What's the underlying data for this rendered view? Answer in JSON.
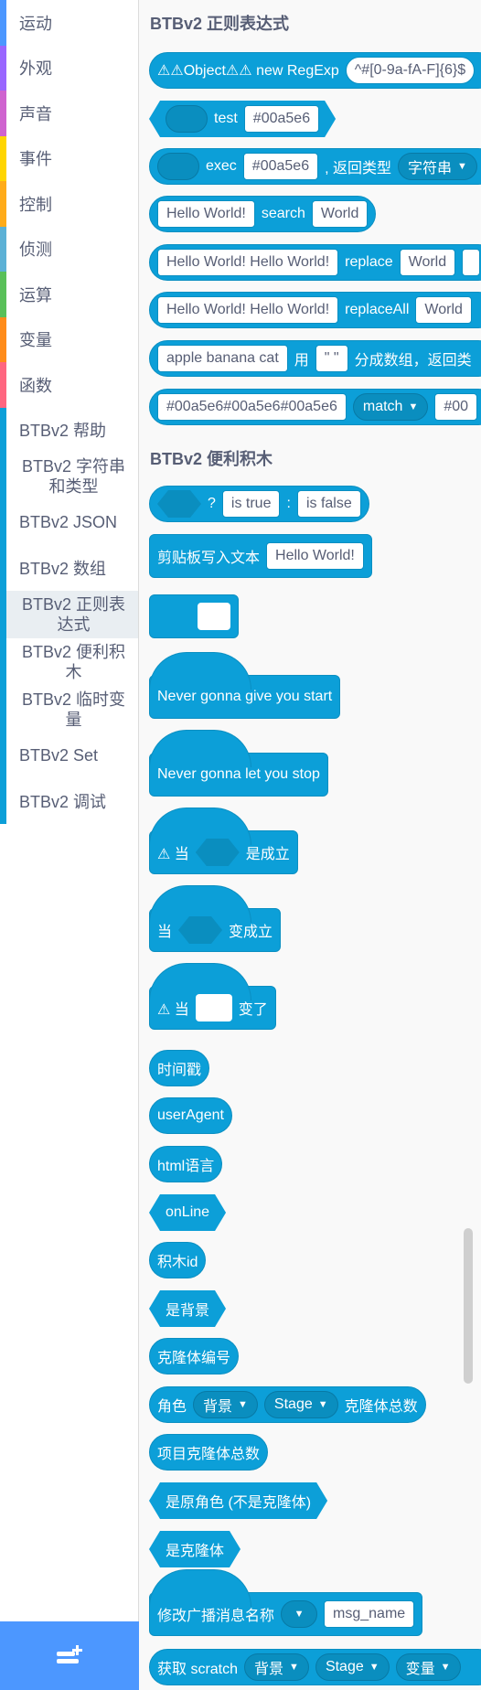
{
  "categories": [
    {
      "label": "运动",
      "color": "#4c97ff"
    },
    {
      "label": "外观",
      "color": "#9966ff"
    },
    {
      "label": "声音",
      "color": "#cf63cf"
    },
    {
      "label": "事件",
      "color": "#ffd500"
    },
    {
      "label": "控制",
      "color": "#ffab19"
    },
    {
      "label": "侦测",
      "color": "#5cb1d6"
    },
    {
      "label": "运算",
      "color": "#59c059"
    },
    {
      "label": "变量",
      "color": "#ff8c1a"
    },
    {
      "label": "函数",
      "color": "#ff6680"
    },
    {
      "label": "BTBv2 帮助",
      "color": "#0c9fd8"
    },
    {
      "label": "BTBv2 字符串和类型",
      "color": "#0c9fd8"
    },
    {
      "label": "BTBv2 JSON",
      "color": "#0c9fd8"
    },
    {
      "label": "BTBv2 数组",
      "color": "#0c9fd8"
    },
    {
      "label": "BTBv2 正则表达式",
      "color": "#0c9fd8"
    },
    {
      "label": "BTBv2 便利积木",
      "color": "#0c9fd8"
    },
    {
      "label": "BTBv2 临时变量",
      "color": "#0c9fd8"
    },
    {
      "label": "BTBv2 Set",
      "color": "#0c9fd8"
    },
    {
      "label": "BTBv2 调试",
      "color": "#0c9fd8"
    }
  ],
  "sections": {
    "regex_title": "BTBv2 正则表达式",
    "convenience_title": "BTBv2 便利积木"
  },
  "regex_blocks": {
    "new_regexp": {
      "label": "⚠⚠Object⚠⚠ new RegExp",
      "value": "^#[0-9a-fA-F]{6}$"
    },
    "test": {
      "label": "test",
      "value": "#00a5e6"
    },
    "exec": {
      "label": "exec",
      "value": "#00a5e6",
      "suffix": ", 返回类型",
      "type": "字符串"
    },
    "search": {
      "text": "Hello World!",
      "label": "search",
      "value": "World"
    },
    "replace": {
      "text": "Hello World! Hello World!",
      "label": "replace",
      "value": "World"
    },
    "replace_all": {
      "text": "Hello World! Hello World!",
      "label": "replaceAll",
      "value": "World"
    },
    "split": {
      "text": "apple banana cat",
      "label": "用",
      "sep": "\" \"",
      "suffix": "分成数组，返回类"
    },
    "match": {
      "text": "#00a5e6#00a5e6#00a5e6",
      "mode": "match",
      "value": "#00"
    }
  },
  "convenience_blocks": {
    "ternary": {
      "q": "?",
      "t": "is true",
      "colon": ":",
      "f": "is false"
    },
    "clipboard": {
      "label": "剪贴板写入文本",
      "value": "Hello World!"
    },
    "start": {
      "label": "Never gonna give you start"
    },
    "stop": {
      "label": "Never gonna let you stop"
    },
    "when_true": {
      "warn": "⚠ 当",
      "suffix": "是成立"
    },
    "when_becomes": {
      "prefix": "当",
      "suffix": "变成立"
    },
    "when_changes": {
      "warn": "⚠ 当",
      "suffix": "变了"
    },
    "timestamp": "时间戳",
    "user_agent": "userAgent",
    "html_lang": "html语言",
    "online": "onLine",
    "block_id": "积木id",
    "is_backdrop": "是背景",
    "clone_number": "克隆体编号",
    "sprite_clones": {
      "prefix": "角色",
      "d1": "背景",
      "d2": "Stage",
      "suffix": "克隆体总数"
    },
    "project_clones": "项目克隆体总数",
    "is_original": "是原角色 (不是克隆体)",
    "is_clone": "是克隆体",
    "rename_broadcast": {
      "label": "修改广播消息名称",
      "value": "msg_name"
    },
    "get_scratch": {
      "label": "获取 scratch",
      "d1": "背景",
      "d2": "Stage",
      "d3": "变量"
    }
  },
  "colors": {
    "block": "#0c9fd8",
    "block_dark": "#0a8ebf",
    "text": "#575e75"
  }
}
